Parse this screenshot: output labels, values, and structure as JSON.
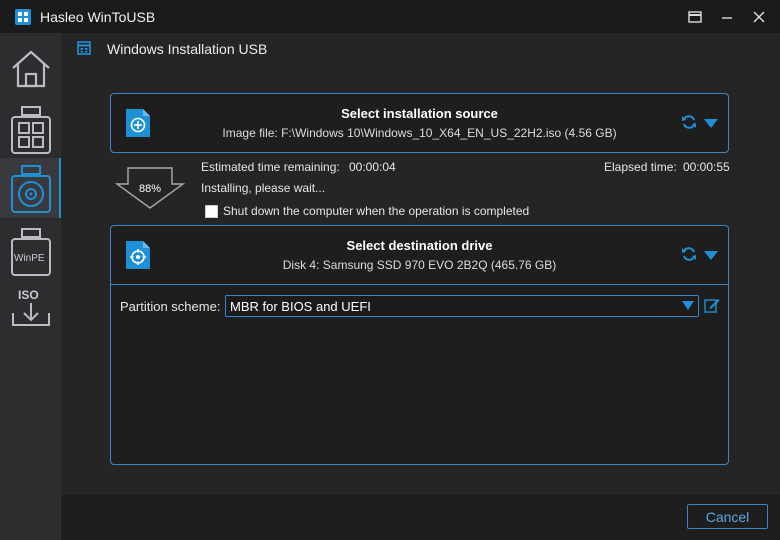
{
  "window": {
    "title": "Hasleo WinToUSB",
    "icons": [
      "app-logo-icon",
      "menu-icon",
      "minimize-icon",
      "maximize-icon",
      "close-icon"
    ]
  },
  "sidebar": {
    "items": [
      {
        "name": "home",
        "icon": "home-icon",
        "label": ""
      },
      {
        "name": "windows-to-go",
        "icon": "windows-usb-icon",
        "label": ""
      },
      {
        "name": "windows-installation-usb",
        "icon": "disc-usb-icon",
        "label": "",
        "active": true
      },
      {
        "name": "winpe",
        "icon": "winpe-usb-icon",
        "label": "WinPE"
      },
      {
        "name": "iso-download",
        "icon": "iso-download-icon",
        "label": "ISO"
      }
    ]
  },
  "header": {
    "title": "Windows Installation USB",
    "icon": "window-icon"
  },
  "source": {
    "title": "Select installation source",
    "subtitle": "Image file: F:\\Windows 10\\Windows_10_X64_EN_US_22H2.iso (4.56 GB)",
    "icon": "add-file-icon"
  },
  "progress": {
    "percent_label": "88%",
    "percent": 88,
    "estimated_label": "Estimated time remaining:",
    "estimated_value": "00:00:04",
    "elapsed_label": "Elapsed time:",
    "elapsed_value": "00:00:55",
    "status": "Installing, please wait...",
    "shutdown_label": "Shut down the computer when the operation is completed",
    "shutdown_checked": false
  },
  "destination": {
    "title": "Select destination drive",
    "subtitle": "Disk 4: Samsung SSD 970 EVO 2B2Q (465.76 GB)",
    "icon": "target-file-icon",
    "partition_label": "Partition scheme:",
    "partition_value": "MBR for BIOS and UEFI",
    "edit_icon": "edit-icon"
  },
  "footer": {
    "cancel_label": "Cancel"
  },
  "colors": {
    "accent": "#1e90d6",
    "panel_border": "#3a86c8",
    "background": "#1e1e1e",
    "sidebar": "#2d2d30"
  }
}
